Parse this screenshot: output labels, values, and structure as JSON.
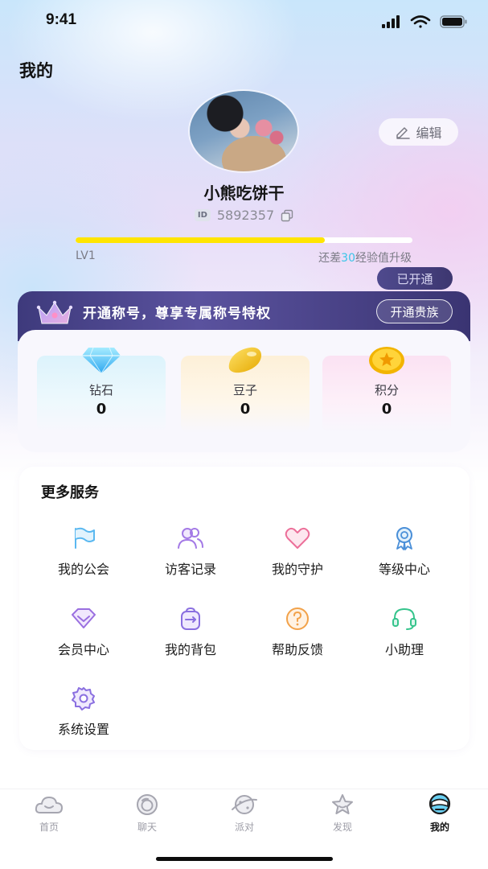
{
  "status_bar": {
    "time": "9:41"
  },
  "header": {
    "title": "我的",
    "edit_label": "编辑"
  },
  "profile": {
    "nickname": "小熊吃饼干",
    "id_chip": "ID",
    "id_value": "5892357",
    "level": "LV1",
    "exp_progress": 0.74,
    "exp_note_prefix": "还差",
    "exp_note_amount": "30",
    "exp_note_suffix": "经验值升级"
  },
  "noble": {
    "activated_label": "已开通",
    "banner_text": "开通称号，尊享专属称号特权",
    "button_label": "开通贵族"
  },
  "wallet": [
    {
      "label": "钻石",
      "value": "0"
    },
    {
      "label": "豆子",
      "value": "0"
    },
    {
      "label": "积分",
      "value": "0"
    }
  ],
  "services": {
    "title": "更多服务",
    "items": [
      {
        "label": "我的公会",
        "icon": "flag-icon"
      },
      {
        "label": "访客记录",
        "icon": "visitors-icon"
      },
      {
        "label": "我的守护",
        "icon": "heart-icon"
      },
      {
        "label": "等级中心",
        "icon": "medal-icon"
      },
      {
        "label": "会员中心",
        "icon": "diamond-outline-icon"
      },
      {
        "label": "我的背包",
        "icon": "backpack-icon"
      },
      {
        "label": "帮助反馈",
        "icon": "help-icon"
      },
      {
        "label": "小助理",
        "icon": "headset-icon"
      },
      {
        "label": "系统设置",
        "icon": "gear-icon"
      }
    ]
  },
  "tabs": [
    {
      "label": "首页",
      "icon": "home-cloud-icon",
      "active": false
    },
    {
      "label": "聊天",
      "icon": "chat-icon",
      "active": false
    },
    {
      "label": "派对",
      "icon": "party-planet-icon",
      "active": false
    },
    {
      "label": "发现",
      "icon": "discover-star-icon",
      "active": false
    },
    {
      "label": "我的",
      "icon": "profile-face-icon",
      "active": true
    }
  ],
  "colors": {
    "progress": "#ffe500",
    "highlight": "#3ac5e8",
    "noble_bg": "#3e3a7c",
    "icon_blue": "#5ab8f0",
    "icon_purple": "#a47ae6",
    "icon_pink": "#ec6f99",
    "icon_orange": "#f2a24a",
    "icon_green": "#35c48c"
  }
}
